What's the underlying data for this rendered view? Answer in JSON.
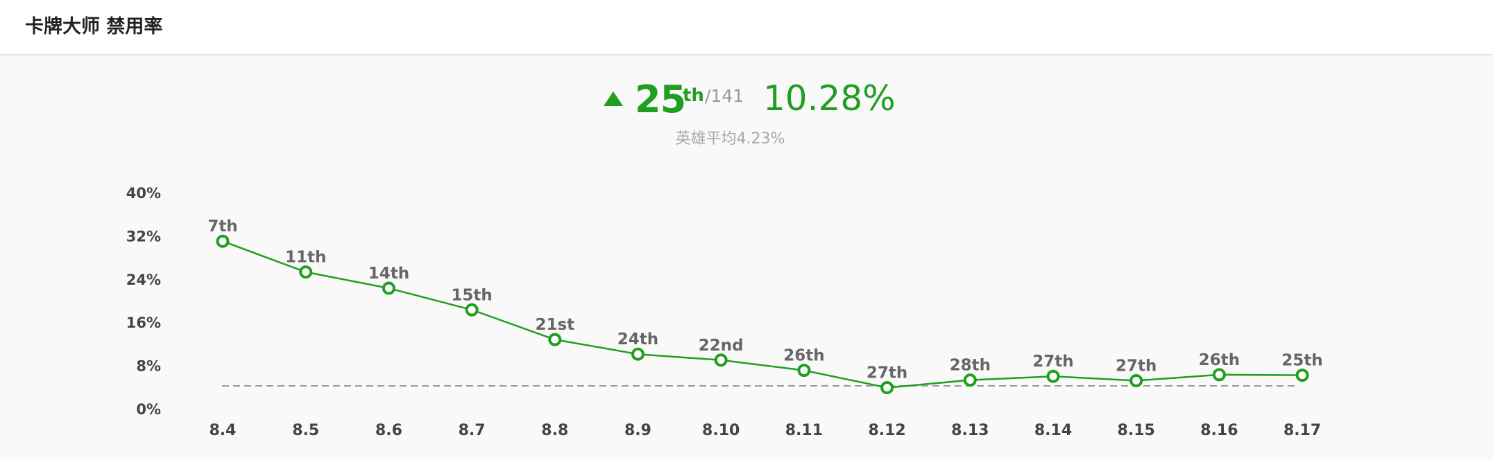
{
  "header": {
    "title": "卡牌大师 禁用率"
  },
  "summary": {
    "rank": "25",
    "rank_suffix": "th",
    "rank_total": "/141",
    "rate": "10.28%",
    "average": "英雄平均4.23%",
    "trend": "up-triangle-icon"
  },
  "colors": {
    "accent": "#1f9e1f",
    "reference_line": "#999999"
  },
  "chart_data": {
    "type": "line",
    "title": "",
    "xlabel": "",
    "ylabel": "",
    "categories": [
      "8.4",
      "8.5",
      "8.6",
      "8.7",
      "8.8",
      "8.9",
      "8.10",
      "8.11",
      "8.12",
      "8.13",
      "8.14",
      "8.15",
      "8.16",
      "8.17"
    ],
    "series": [
      {
        "values": [
          31.0,
          25.3,
          22.3,
          18.3,
          12.8,
          10.1,
          9.0,
          7.1,
          3.9,
          5.3,
          6.0,
          5.2,
          6.3,
          6.2
        ],
        "point_labels": [
          "7th",
          "11th",
          "14th",
          "15th",
          "21st",
          "24th",
          "22nd",
          "26th",
          "27th",
          "28th",
          "27th",
          "27th",
          "26th",
          "25th"
        ]
      }
    ],
    "reference_line": {
      "value": 4.23,
      "style": "dashed"
    },
    "ylim": [
      0,
      40
    ],
    "y_ticks": [
      "0%",
      "8%",
      "16%",
      "24%",
      "32%",
      "40%"
    ],
    "grid": false,
    "legend": "none"
  }
}
